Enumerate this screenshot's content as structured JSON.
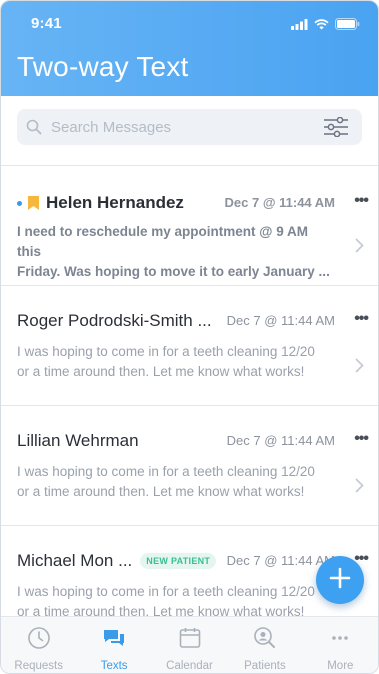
{
  "status_bar": {
    "time": "9:41"
  },
  "header": {
    "title": "Two-way Text"
  },
  "search": {
    "placeholder": "Search Messages"
  },
  "messages": [
    {
      "name": "Helen Hernandez",
      "date": "Dec 7 @ 11:44 AM",
      "more": "•••",
      "preview_line1": "I need to reschedule my appointment @ 9 AM this",
      "preview_line2": "Friday. Was hoping to move it to early January ...",
      "unread": true,
      "flagged": true
    },
    {
      "name": "Roger Podrodski-Smith ...",
      "date": "Dec 7 @ 11:44 AM",
      "more": "•••",
      "preview_line1": "I was hoping to come in for a teeth cleaning 12/20",
      "preview_line2": "or a time around then. Let me know what works!"
    },
    {
      "name": "Lillian Wehrman",
      "date": "Dec 7 @ 11:44 AM",
      "more": "•••",
      "preview_line1": "I was hoping to come in for a teeth cleaning 12/20",
      "preview_line2": "or a time around then. Let me know what works!"
    },
    {
      "name": "Michael Mon ...",
      "badge": "NEW PATIENT",
      "date": "Dec 7 @ 11:44 AM",
      "more": "•••",
      "preview_line1": "I was hoping to come in for a teeth cleaning 12/20",
      "preview_line2": "or a time around then. Let me know what works!"
    }
  ],
  "fab": {
    "icon": "plus-icon"
  },
  "tabs": [
    {
      "label": "Requests",
      "icon": "clock-icon",
      "active": false
    },
    {
      "label": "Texts",
      "icon": "chat-icon",
      "active": true
    },
    {
      "label": "Calendar",
      "icon": "calendar-icon",
      "active": false
    },
    {
      "label": "Patients",
      "icon": "patient-search-icon",
      "active": false
    },
    {
      "label": "More",
      "icon": "more-dots-icon",
      "active": false
    }
  ],
  "colors": {
    "accent": "#3b9be8",
    "header_start": "#67b4f5",
    "header_end": "#4aa3f1",
    "badge_green": "#3bbf8f",
    "flag_yellow": "#f6b73c"
  }
}
